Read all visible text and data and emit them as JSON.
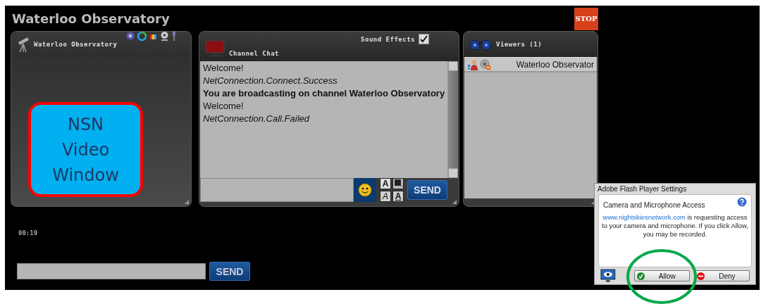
{
  "title": "Waterloo Observatory",
  "stop_sign": {
    "label": "STOP"
  },
  "broadcaster_panel": {
    "title": "Waterloo Observatory",
    "video_label": "NSN Video Window"
  },
  "chat_panel": {
    "title": "Channel Chat",
    "sound_effects": {
      "label": "Sound Effects",
      "checked": true
    },
    "messages": [
      {
        "text": "Welcome!",
        "kind": "plain"
      },
      {
        "text": "NetConnection.Connect.Success",
        "kind": "italic"
      },
      {
        "text": "You are broadcasting on channel Waterloo Observatory",
        "kind": "bold"
      },
      {
        "text": "Welcome!",
        "kind": "plain"
      },
      {
        "text": "NetConnection.Call.Failed",
        "kind": "italic"
      }
    ],
    "format_buttons": [
      {
        "label": "A",
        "kind": "bold"
      },
      {
        "kind": "color"
      },
      {
        "label": "A",
        "kind": "italic"
      },
      {
        "label": "A",
        "kind": "underline"
      }
    ],
    "send_label": "SEND"
  },
  "viewers_panel": {
    "title": "Viewers (1)",
    "viewers": [
      {
        "name": "Waterloo Observator"
      }
    ]
  },
  "timer": "00:19",
  "bottom_send_label": "SEND",
  "flash_dialog": {
    "title": "Adobe Flash Player Settings",
    "heading": "Camera and Microphone Access",
    "link": "www.nightskiesnetwork.com",
    "message": " is requesting access to your camera and microphone. If you click Allow, you may be recorded.",
    "buttons": [
      {
        "label": "Allow",
        "kind": "allow"
      },
      {
        "label": "Deny",
        "kind": "deny"
      }
    ]
  }
}
